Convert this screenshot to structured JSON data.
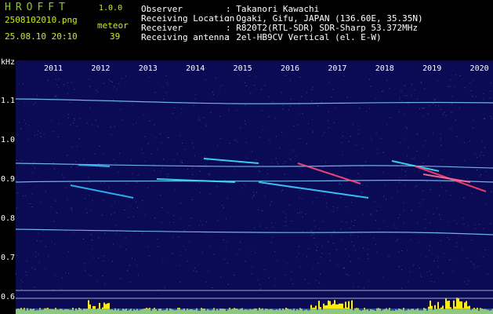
{
  "app": {
    "logo": "HROFFT",
    "version": "1.0.0",
    "filename": "2508102010.png",
    "datetime": "25.08.10 20:10",
    "meteor_label": "meteor",
    "meteor_count": "39"
  },
  "info": {
    "observer_label": "Observer",
    "observer_value": ": Takanori Kawachi",
    "location_label": "Receiving Location",
    "location_value": ": Ogaki, Gifu, JAPAN (136.60E, 35.35N)",
    "receiver_label": "Receiver",
    "receiver_value": ": R820T2(RTL-SDR) SDR-Sharp 53.372MHz",
    "antenna_label": "Receiving antenna",
    "antenna_value": ": 2el-HB9CV Vertical (el. E-W)"
  },
  "axis": {
    "unit": "kHz",
    "y_ticks": [
      "1.1",
      "1.0",
      "0.9",
      "0.8",
      "0.7",
      "0.6"
    ],
    "x_ticks": [
      "2011",
      "2012",
      "2013",
      "2014",
      "2015",
      "2016",
      "2017",
      "2018",
      "2019",
      "2020"
    ]
  },
  "colors": {
    "background": "#000000",
    "spectrum_bg": "#0a0a55",
    "trace": "#7fd0ff",
    "meteor": "#ff4060",
    "activity": "#ffee00",
    "label": "#c8f000"
  }
}
